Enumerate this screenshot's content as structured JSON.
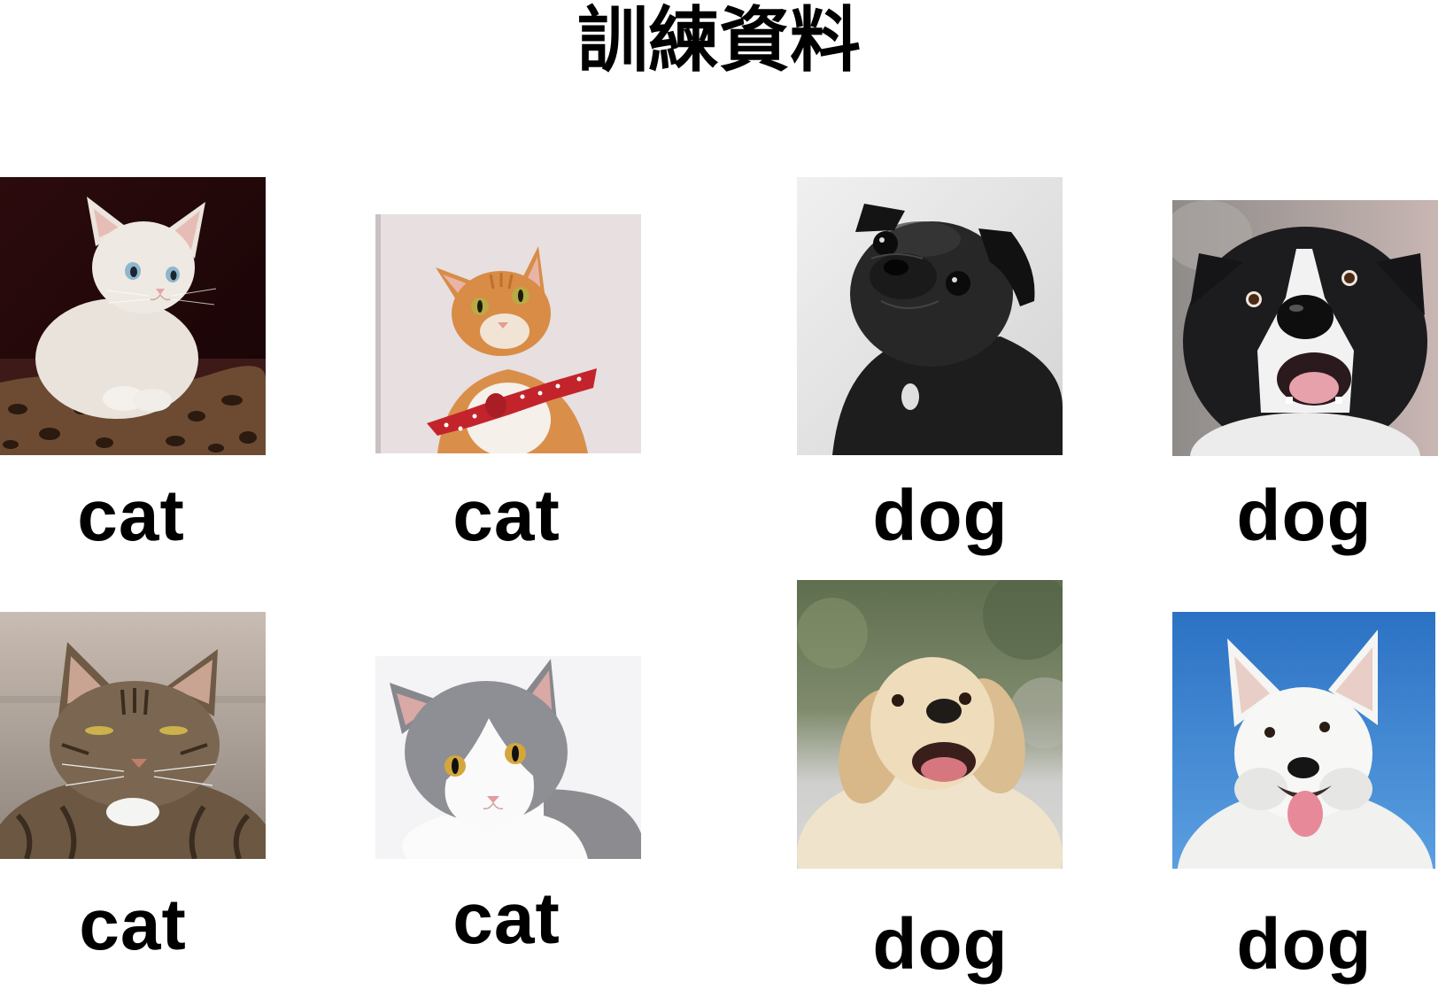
{
  "title": "訓練資料",
  "samples": [
    {
      "label": "cat"
    },
    {
      "label": "cat"
    },
    {
      "label": "dog"
    },
    {
      "label": "dog"
    },
    {
      "label": "cat"
    },
    {
      "label": "cat"
    },
    {
      "label": "dog"
    },
    {
      "label": "dog"
    }
  ]
}
